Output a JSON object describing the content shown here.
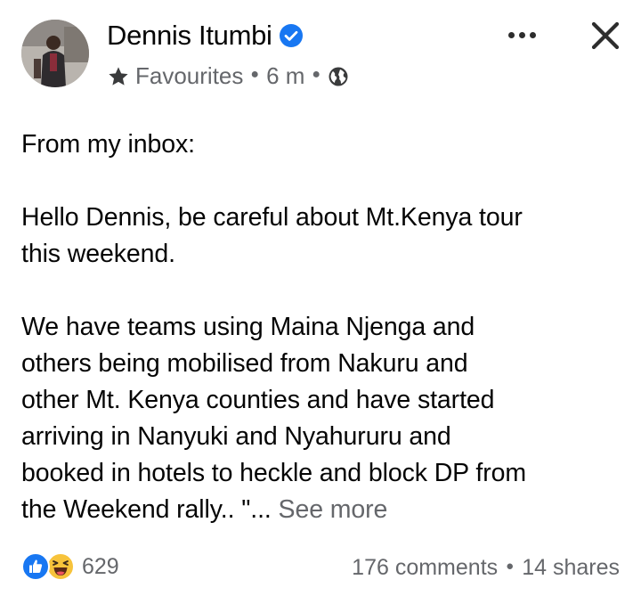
{
  "post": {
    "author": "Dennis Itumbi",
    "audience": "Favourites",
    "time": "6 m",
    "lines": {
      "l1": "From my inbox:",
      "l2": "Hello Dennis, be careful about Mt.Kenya tour",
      "l3": "this weekend.",
      "l4": "We have teams using Maina Njenga and",
      "l5": "others being mobilised from Nakuru and",
      "l6": "other Mt. Kenya counties and have started",
      "l7": "arriving in Nanyuki and Nyahururu and",
      "l8": "booked in hotels to heckle and block DP from",
      "l9": "the Weekend rally.. \"..."
    },
    "see_more": "See more"
  },
  "stats": {
    "reactions_count": "629",
    "comments": "176 comments",
    "shares": "14 shares"
  },
  "icons": {
    "verified": "verified-badge-icon",
    "audience": "star-icon",
    "privacy": "globe-icon",
    "more": "more-options-icon",
    "close": "close-icon",
    "reaction1": "like-reaction-icon",
    "reaction2": "haha-reaction-icon"
  },
  "colors": {
    "brand_blue": "#1877f2",
    "secondary_text": "#65676b",
    "primary_text": "#050505"
  }
}
